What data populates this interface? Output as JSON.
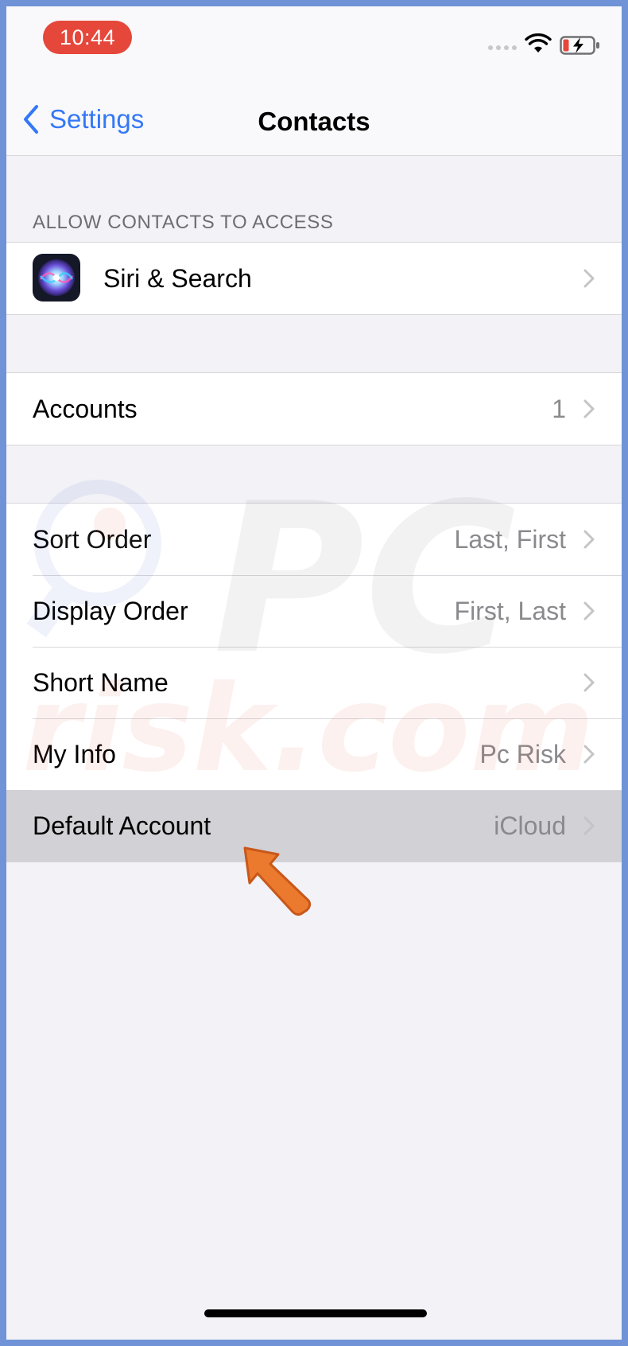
{
  "status_bar": {
    "time": "10:44"
  },
  "nav": {
    "back_label": "Settings",
    "title": "Contacts"
  },
  "sections": {
    "access_header": "ALLOW CONTACTS TO ACCESS"
  },
  "siri_row": {
    "label": "Siri & Search",
    "icon": "siri-icon"
  },
  "accounts_row": {
    "label": "Accounts",
    "value": "1"
  },
  "settings_rows": [
    {
      "label": "Sort Order",
      "value": "Last, First"
    },
    {
      "label": "Display Order",
      "value": "First, Last"
    },
    {
      "label": "Short Name",
      "value": ""
    },
    {
      "label": "My Info",
      "value": "Pc Risk"
    },
    {
      "label": "Default Account",
      "value": "iCloud"
    }
  ],
  "watermark": {
    "text_top": "PC",
    "text_bottom": "risk.com"
  },
  "colors": {
    "accent": "#3478f6",
    "time_pill": "#e5473b",
    "background": "#f2f2f7",
    "highlight": "#d1d1d6",
    "annotation_arrow": "#ec7a2e",
    "frame": "#6f93d6"
  }
}
